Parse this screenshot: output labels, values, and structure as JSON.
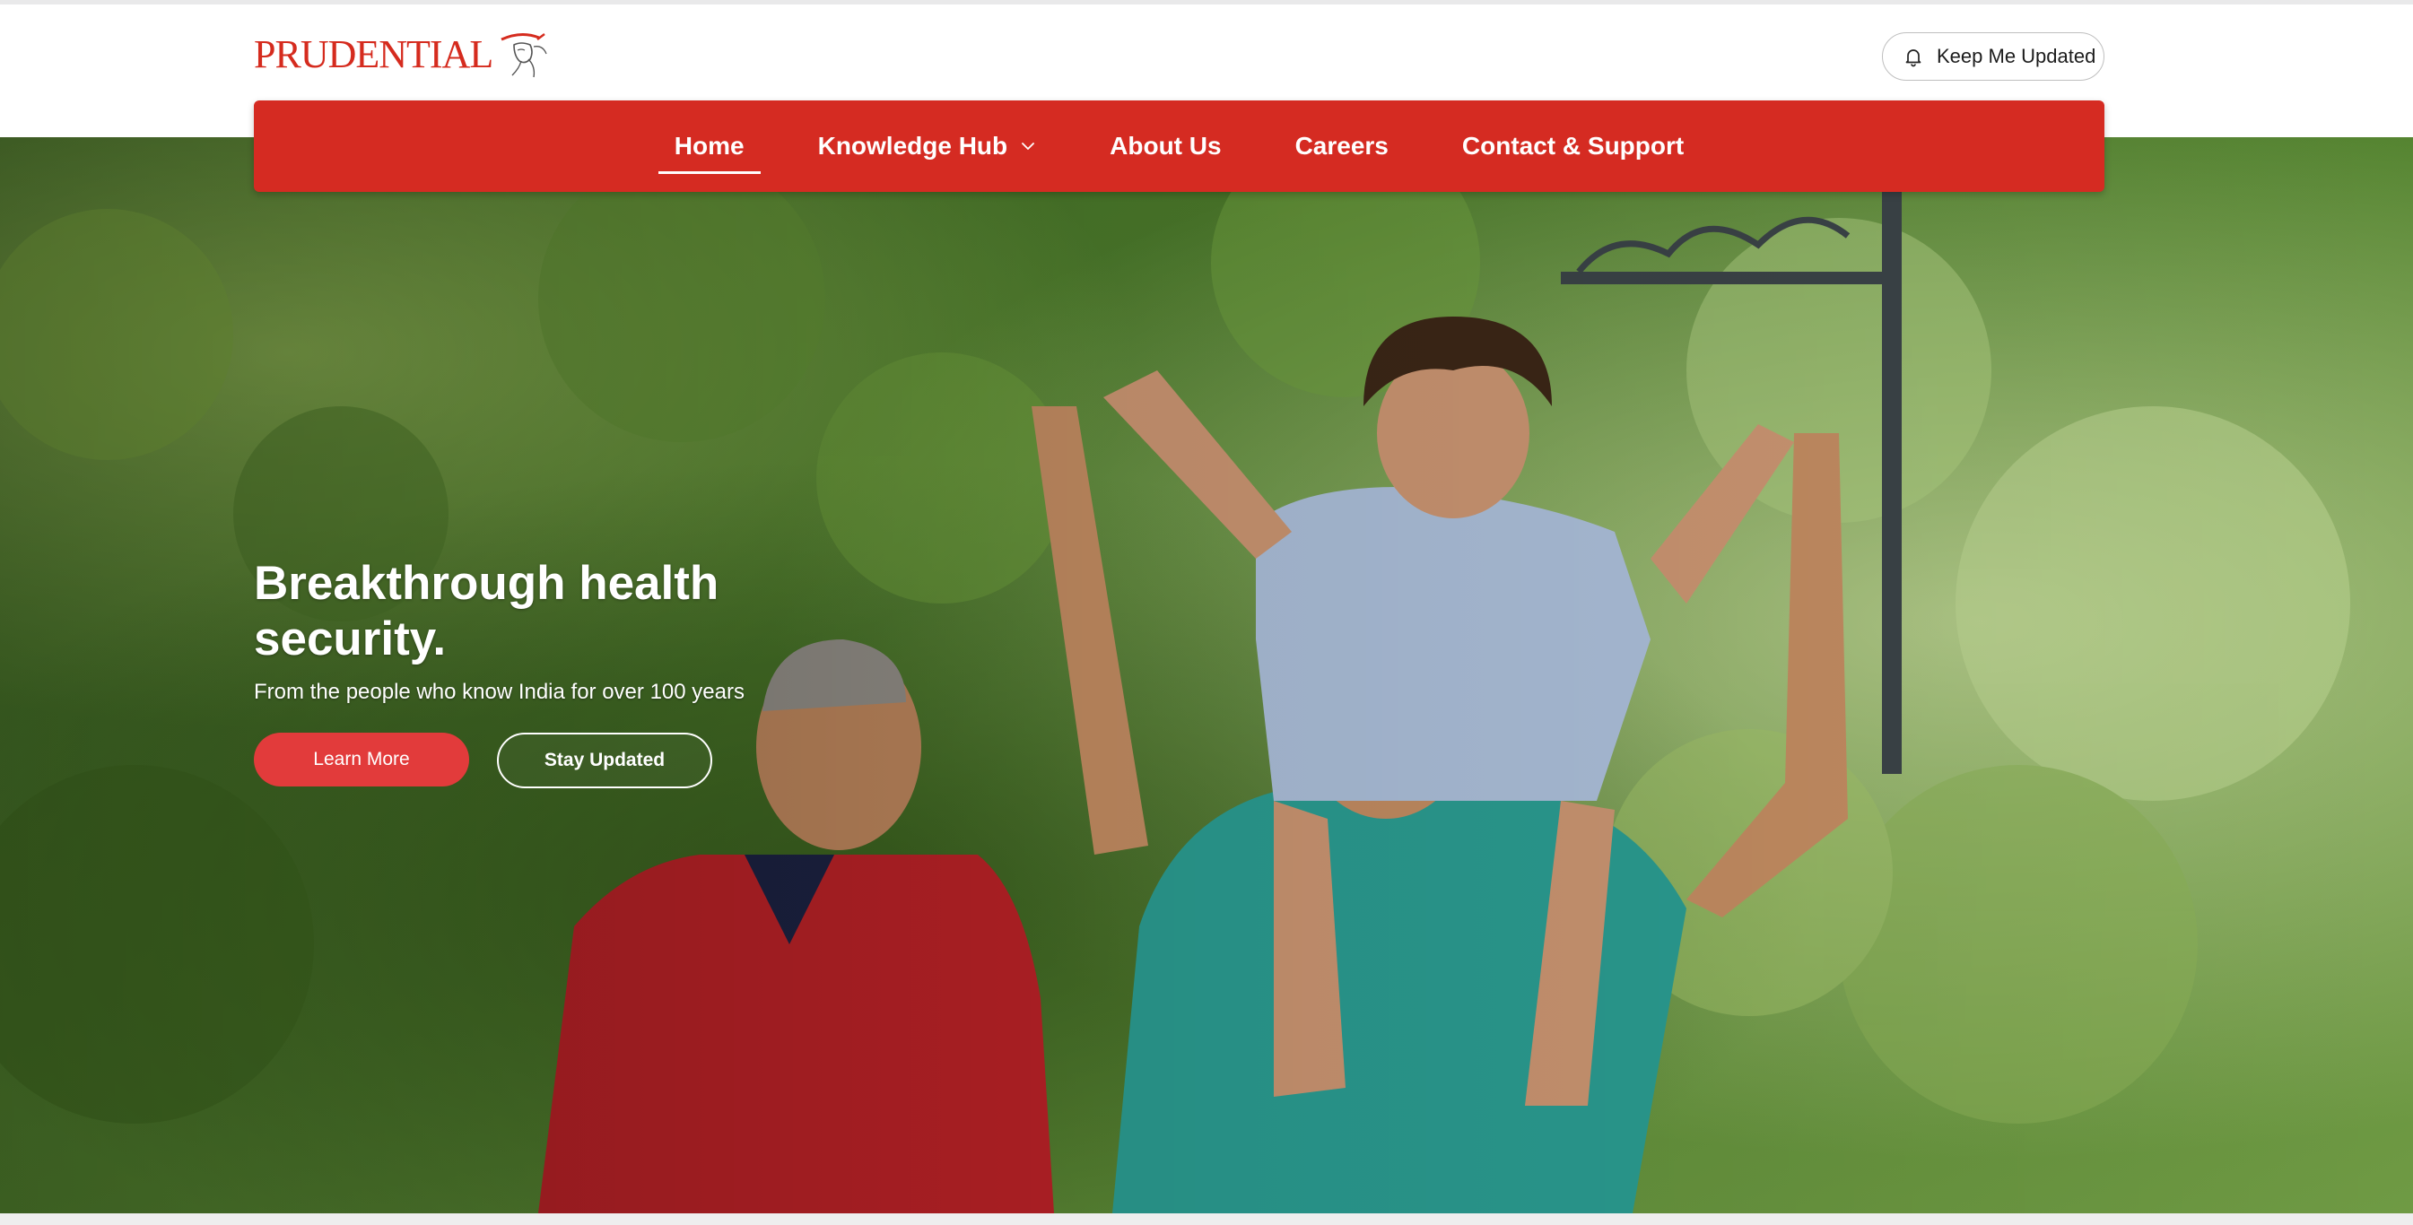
{
  "brand": {
    "logo_text": "PRUDENTIAL",
    "logo_alt": "Prudential logo",
    "primary_color": "#d52b22",
    "button_red": "#e23b3b"
  },
  "header": {
    "keep_updated_label": "Keep Me Updated",
    "keep_updated_icon": "bell-icon"
  },
  "nav": {
    "items": [
      {
        "label": "Home",
        "active": true
      },
      {
        "label": "Knowledge Hub",
        "has_dropdown": true,
        "icon": "chevron-down-icon"
      },
      {
        "label": "About Us"
      },
      {
        "label": "Careers"
      },
      {
        "label": "Contact & Support"
      }
    ]
  },
  "hero": {
    "title_line1": "Breakthrough health",
    "title_line2": "security.",
    "subtitle": "From the people who know India for over 100 years",
    "learn_more_label": "Learn More",
    "stay_updated_label": "Stay Updated",
    "image_alt": "Grandfather, father and child smiling outdoors among green trees"
  }
}
